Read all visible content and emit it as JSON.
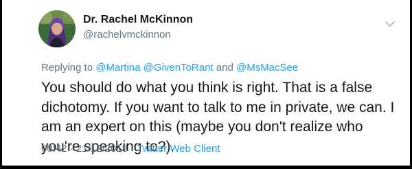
{
  "author": {
    "display_name": "Dr. Rachel McKinnon",
    "handle": "@rachelvmckinnon"
  },
  "reply_context": {
    "prefix": "Replying to ",
    "mentions": [
      "@Martina",
      "@GivenToRant",
      "@MsMacSee"
    ],
    "separator_1": " ",
    "separator_2": " and "
  },
  "tweet": {
    "text": "You should do what you think is right. That is a false dichotomy. If you want to talk to me in private, we can. I am an expert on this (maybe you don't realize who you're speaking to?)."
  },
  "meta": {
    "time": "00:42",
    "date": "21/12/2018",
    "separator": " · ",
    "client": "Twitter Web Client"
  },
  "icons": {
    "more": "chevron-down-icon"
  },
  "colors": {
    "link": "#1da1f2",
    "secondary_text": "#657786",
    "primary_text": "#14171a"
  }
}
